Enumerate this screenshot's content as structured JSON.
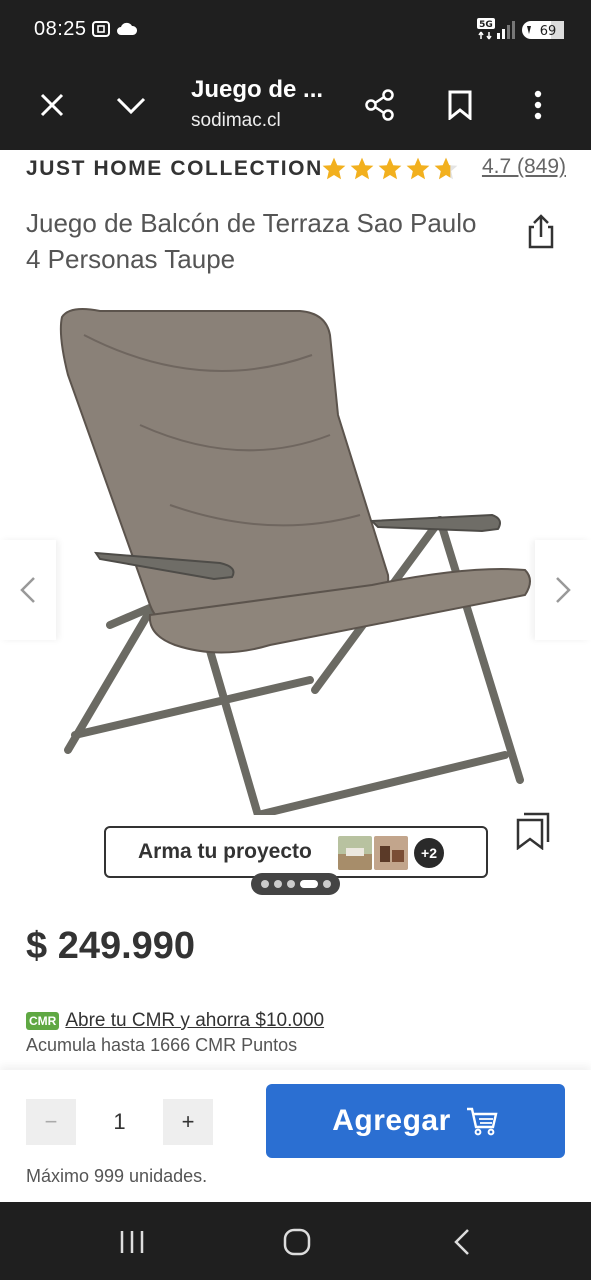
{
  "status_bar": {
    "time": "08:25",
    "network": "5G",
    "battery": "69"
  },
  "browser": {
    "title": "Juego de ...",
    "url": "sodimac.cl"
  },
  "product": {
    "brand": "JUST HOME COLLECTION",
    "rating_value": 4.7,
    "rating_max": 5,
    "rating_text": "4.7 (849)",
    "title": "Juego de Balcón de Terraza Sao Paulo 4 Personas Taupe",
    "price": "$ 249.990"
  },
  "carousel": {
    "project_label": "Arma tu proyecto",
    "more_count": "+2",
    "slide_count": 5,
    "active_slide": 4
  },
  "cmr": {
    "badge": "CMR",
    "offer": "Abre tu CMR y ahorra $10.000",
    "points": "Acumula hasta 1666 CMR Puntos"
  },
  "purchase": {
    "minus": "−",
    "quantity": "1",
    "plus": "+",
    "add_label": "Agregar",
    "max_units": "Máximo 999 unidades."
  },
  "colors": {
    "accent": "#2b6fd2",
    "star": "#f2b01e",
    "cmr": "#5fa843",
    "chrome": "#1f1f1f"
  }
}
